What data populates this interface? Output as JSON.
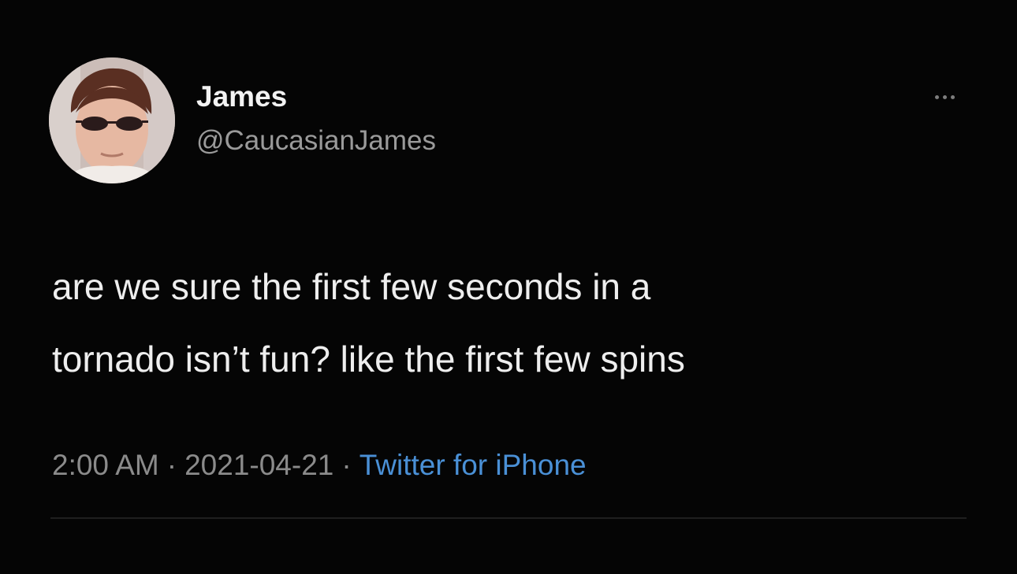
{
  "tweet": {
    "author": {
      "display_name": "James",
      "handle": "@CaucasianJames"
    },
    "more_icon": "more-horizontal-icon",
    "text_lines": [
      "are we sure the first few seconds in a",
      "tornado isn’t fun? like the first few spins"
    ],
    "meta": {
      "time": "2:00 AM",
      "separator": "·",
      "date": "2021-04-21",
      "source": "Twitter for iPhone"
    },
    "colors": {
      "background": "#050505",
      "text": "#eeeeee",
      "secondary_text": "#8b8b8b",
      "link": "#4a90d6"
    }
  }
}
